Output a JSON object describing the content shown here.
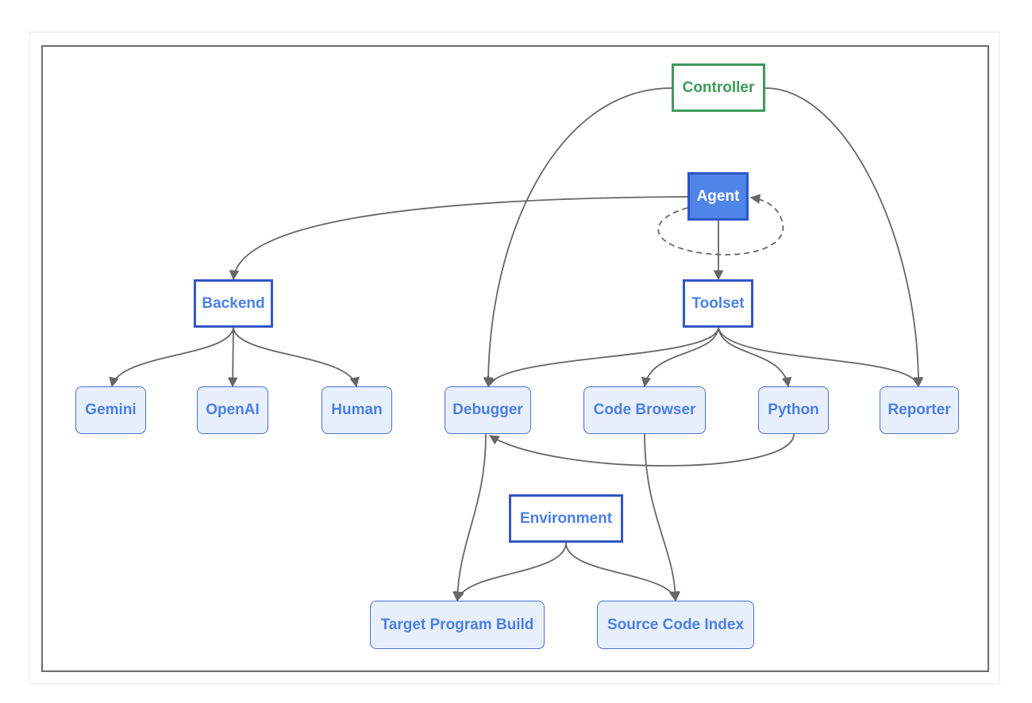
{
  "colors": {
    "controller": "#3d9a5a",
    "agent_fill": "#4f84e8",
    "box_border": "#3355c6",
    "text_blue": "#4a7fe6",
    "leaf_fill": "#e8effc",
    "edge": "#666666"
  },
  "nodes": {
    "controller": "Controller",
    "agent": "Agent",
    "backend": "Backend",
    "toolset": "Toolset",
    "gemini": "Gemini",
    "openai": "OpenAI",
    "human": "Human",
    "debugger": "Debugger",
    "code_browser": "Code Browser",
    "python": "Python",
    "reporter": "Reporter",
    "environment": "Environment",
    "target_program_build": "Target Program Build",
    "source_code_index": "Source Code Index"
  },
  "edges": [
    {
      "from": "controller",
      "to": "debugger"
    },
    {
      "from": "controller",
      "to": "reporter"
    },
    {
      "from": "agent",
      "to": "backend"
    },
    {
      "from": "agent",
      "to": "toolset"
    },
    {
      "from": "agent",
      "to": "agent",
      "style": "dashed"
    },
    {
      "from": "backend",
      "to": "gemini"
    },
    {
      "from": "backend",
      "to": "openai"
    },
    {
      "from": "backend",
      "to": "human"
    },
    {
      "from": "toolset",
      "to": "debugger"
    },
    {
      "from": "toolset",
      "to": "code_browser"
    },
    {
      "from": "toolset",
      "to": "python"
    },
    {
      "from": "toolset",
      "to": "reporter"
    },
    {
      "from": "python",
      "to": "debugger"
    },
    {
      "from": "debugger",
      "to": "target_program_build"
    },
    {
      "from": "code_browser",
      "to": "source_code_index"
    },
    {
      "from": "environment",
      "to": "target_program_build"
    },
    {
      "from": "environment",
      "to": "source_code_index"
    }
  ]
}
